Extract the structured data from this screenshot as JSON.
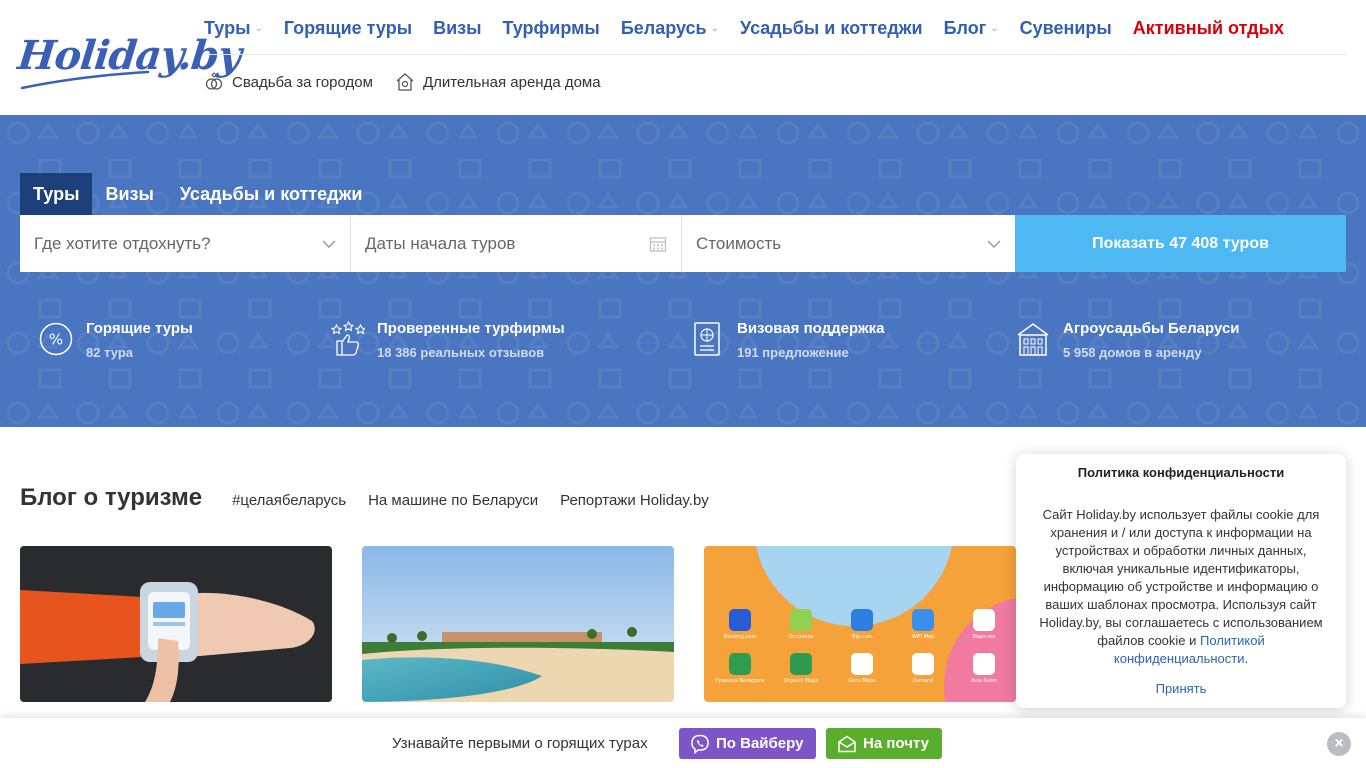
{
  "header": {
    "logo_text": "Holiday.by",
    "nav": [
      {
        "label": "Туры",
        "has_dropdown": true
      },
      {
        "label": "Горящие туры",
        "has_dropdown": false
      },
      {
        "label": "Визы",
        "has_dropdown": false
      },
      {
        "label": "Турфирмы",
        "has_dropdown": false
      },
      {
        "label": "Беларусь",
        "has_dropdown": true
      },
      {
        "label": "Усадьбы и коттеджи",
        "has_dropdown": false
      },
      {
        "label": "Блог",
        "has_dropdown": true
      },
      {
        "label": "Сувениры",
        "has_dropdown": false
      },
      {
        "label": "Активный отдых",
        "has_dropdown": false,
        "color": "#d8000c"
      }
    ],
    "subnav": [
      {
        "label": "Свадьба за городом",
        "icon": "rings-icon"
      },
      {
        "label": "Длительная аренда дома",
        "icon": "house-icon"
      }
    ]
  },
  "search": {
    "tabs": [
      "Туры",
      "Визы",
      "Усадьбы и коттеджи"
    ],
    "active_tab": "Туры",
    "destination_placeholder": "Где хотите отдохнуть?",
    "dates_placeholder": "Даты начала туров",
    "price_placeholder": "Стоимость",
    "submit_label": "Показать 47 408 туров"
  },
  "features": [
    {
      "title": "Горящие туры",
      "sub": "82 тура",
      "icon": "percent-icon"
    },
    {
      "title": "Проверенные турфирмы",
      "sub": "18 386 реальных отзывов",
      "icon": "thumbs-up-stars-icon"
    },
    {
      "title": "Визовая поддержка",
      "sub": "191 предложение",
      "icon": "passport-icon"
    },
    {
      "title": "Агроусадьбы Беларуси",
      "sub": "5 958 домов в аренду",
      "icon": "estate-icon"
    }
  ],
  "blog": {
    "title": "Блог о туризме",
    "tags": [
      "#целаябеларусь",
      "На машине по Беларуси",
      "Репортажи Holiday.by"
    ],
    "cards": [
      {
        "image": "smartwatch-photo"
      },
      {
        "image": "beach-photo"
      },
      {
        "image": "phone-apps-screenshot"
      }
    ],
    "app_labels": [
      "Booking.com",
      "Островок",
      "Trip.com",
      "WiFi Map",
      "Maps.me",
      "Граница Беларуси",
      "Organic Maps",
      "Guru Maps",
      "Osmand",
      "Avia Sales"
    ]
  },
  "cookie": {
    "title": "Политика конфиденциальности",
    "text": "Сайт Holiday.by использует файлы cookie для хранения и / или доступа к информации на устройствах и обработки личных данных, включая уникальные идентификаторы, информацию об устройстве и информацию о ваших шаблонах просмотра. Используя сайт Holiday.by, вы соглашаетесь с использованием файлов cookie и",
    "link": "Политикой конфиденциальности",
    "after_link": ".",
    "accept": "Принять"
  },
  "bottom_bar": {
    "text": "Узнавайте первыми о горящих турах",
    "viber_label": "По Вайберу",
    "mail_label": "На почту",
    "close": "×"
  },
  "colors": {
    "brand_blue": "#3160b4",
    "hero_bg": "#4a75c0",
    "search_button": "#4eb8f3",
    "active_tab": "#1d3f7a",
    "viber": "#7d55c7",
    "mail": "#5bad2e",
    "accent_red": "#d8000c"
  }
}
